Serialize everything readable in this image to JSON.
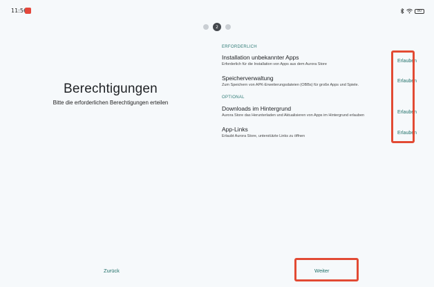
{
  "status_bar": {
    "time": "11:56",
    "battery": "80"
  },
  "stepper": {
    "current": "2"
  },
  "header": {
    "title": "Berechtigungen",
    "subtitle": "Bitte die erforderlichen Berechtigungen erteilen"
  },
  "sections": {
    "required_label": "ERFORDERLICH",
    "optional_label": "OPTIONAL"
  },
  "permissions": [
    {
      "title": "Installation unbekannter Apps",
      "description": "Erforderlich für die Installation von Apps aus dem Aurora Store",
      "action": "Erlauben"
    },
    {
      "title": "Speicherverwaltung",
      "description": "Zum Speichern von APK-Erweiterungsdateien (OBBs) für große Apps und Spiele.",
      "action": "Erlauben"
    },
    {
      "title": "Downloads im Hintergrund",
      "description": "Aurora Store das Herunterladen und Aktualisieren von Apps im Hintergrund erlauben",
      "action": "Erlauben"
    },
    {
      "title": "App-Links",
      "description": "Erlaubt Aurora Store, unterstützte Links zu öffnen",
      "action": "Erlauben"
    }
  ],
  "footer": {
    "back_label": "Zurück",
    "next_label": "Weiter"
  },
  "colors": {
    "accent": "#1f6f68",
    "highlight": "#e24a33",
    "background": "#f6f9fb"
  }
}
